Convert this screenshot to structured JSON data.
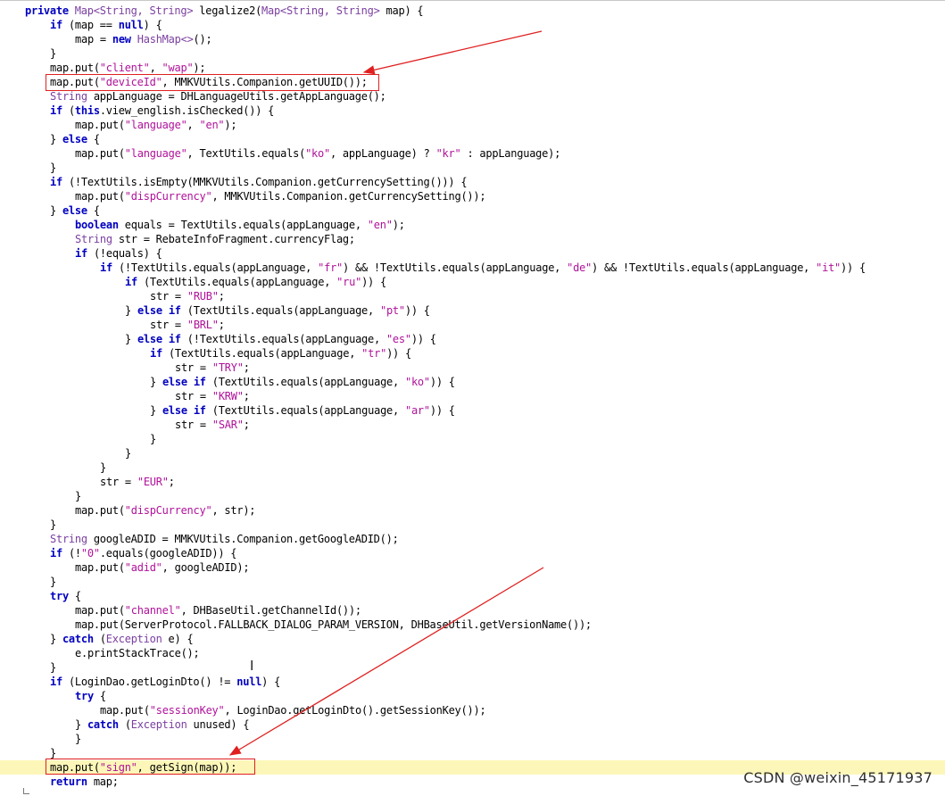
{
  "editor": {
    "highlight_line_index": 53,
    "lines": [
      {
        "indent": 1,
        "tokens": [
          [
            "k",
            "private "
          ],
          [
            "t",
            "Map<String, String> "
          ],
          [
            "p",
            "legalize2("
          ],
          [
            "t",
            "Map<String, String> "
          ],
          [
            "p",
            "map) {"
          ]
        ]
      },
      {
        "indent": 2,
        "tokens": [
          [
            "k",
            "if "
          ],
          [
            "p",
            "(map == "
          ],
          [
            "k",
            "null"
          ],
          [
            "p",
            ") {"
          ]
        ]
      },
      {
        "indent": 3,
        "tokens": [
          [
            "p",
            "map = "
          ],
          [
            "k",
            "new "
          ],
          [
            "t",
            "HashMap<>"
          ],
          [
            "p",
            "();"
          ]
        ]
      },
      {
        "indent": 2,
        "tokens": [
          [
            "p",
            "}"
          ]
        ]
      },
      {
        "indent": 2,
        "tokens": [
          [
            "p",
            "map.put("
          ],
          [
            "s",
            "\"client\""
          ],
          [
            "p",
            ", "
          ],
          [
            "s",
            "\"wap\""
          ],
          [
            "p",
            ");"
          ]
        ]
      },
      {
        "indent": 2,
        "tokens": [
          [
            "p",
            "map.put("
          ],
          [
            "s",
            "\"deviceId\""
          ],
          [
            "p",
            ", MMKVUtils.Companion.getUUID());"
          ]
        ]
      },
      {
        "indent": 2,
        "tokens": [
          [
            "t",
            "String "
          ],
          [
            "p",
            "appLanguage = DHLanguageUtils.getAppLanguage();"
          ]
        ]
      },
      {
        "indent": 2,
        "tokens": [
          [
            "k",
            "if "
          ],
          [
            "p",
            "("
          ],
          [
            "k",
            "this"
          ],
          [
            "p",
            ".view_english.isChecked()) {"
          ]
        ]
      },
      {
        "indent": 3,
        "tokens": [
          [
            "p",
            "map.put("
          ],
          [
            "s",
            "\"language\""
          ],
          [
            "p",
            ", "
          ],
          [
            "s",
            "\"en\""
          ],
          [
            "p",
            ");"
          ]
        ]
      },
      {
        "indent": 2,
        "tokens": [
          [
            "p",
            "} "
          ],
          [
            "k",
            "else "
          ],
          [
            "p",
            "{"
          ]
        ]
      },
      {
        "indent": 3,
        "tokens": [
          [
            "p",
            "map.put("
          ],
          [
            "s",
            "\"language\""
          ],
          [
            "p",
            ", TextUtils.equals("
          ],
          [
            "s",
            "\"ko\""
          ],
          [
            "p",
            ", appLanguage) ? "
          ],
          [
            "s",
            "\"kr\""
          ],
          [
            "p",
            " : appLanguage);"
          ]
        ]
      },
      {
        "indent": 2,
        "tokens": [
          [
            "p",
            "}"
          ]
        ]
      },
      {
        "indent": 2,
        "tokens": [
          [
            "k",
            "if "
          ],
          [
            "p",
            "(!TextUtils.isEmpty(MMKVUtils.Companion.getCurrencySetting())) {"
          ]
        ]
      },
      {
        "indent": 3,
        "tokens": [
          [
            "p",
            "map.put("
          ],
          [
            "s",
            "\"dispCurrency\""
          ],
          [
            "p",
            ", MMKVUtils.Companion.getCurrencySetting());"
          ]
        ]
      },
      {
        "indent": 2,
        "tokens": [
          [
            "p",
            "} "
          ],
          [
            "k",
            "else "
          ],
          [
            "p",
            "{"
          ]
        ]
      },
      {
        "indent": 3,
        "tokens": [
          [
            "k",
            "boolean "
          ],
          [
            "p",
            "equals = TextUtils.equals(appLanguage, "
          ],
          [
            "s",
            "\"en\""
          ],
          [
            "p",
            ");"
          ]
        ]
      },
      {
        "indent": 3,
        "tokens": [
          [
            "t",
            "String "
          ],
          [
            "p",
            "str = RebateInfoFragment.currencyFlag;"
          ]
        ]
      },
      {
        "indent": 3,
        "tokens": [
          [
            "k",
            "if "
          ],
          [
            "p",
            "(!equals) {"
          ]
        ]
      },
      {
        "indent": 4,
        "tokens": [
          [
            "k",
            "if "
          ],
          [
            "p",
            "(!TextUtils.equals(appLanguage, "
          ],
          [
            "s",
            "\"fr\""
          ],
          [
            "p",
            ") && !TextUtils.equals(appLanguage, "
          ],
          [
            "s",
            "\"de\""
          ],
          [
            "p",
            ") && !TextUtils.equals(appLanguage, "
          ],
          [
            "s",
            "\"it\""
          ],
          [
            "p",
            ")) {"
          ]
        ]
      },
      {
        "indent": 5,
        "tokens": [
          [
            "k",
            "if "
          ],
          [
            "p",
            "(TextUtils.equals(appLanguage, "
          ],
          [
            "s",
            "\"ru\""
          ],
          [
            "p",
            ")) {"
          ]
        ]
      },
      {
        "indent": 6,
        "tokens": [
          [
            "p",
            "str = "
          ],
          [
            "s",
            "\"RUB\""
          ],
          [
            "p",
            ";"
          ]
        ]
      },
      {
        "indent": 5,
        "tokens": [
          [
            "p",
            "} "
          ],
          [
            "k",
            "else if "
          ],
          [
            "p",
            "(TextUtils.equals(appLanguage, "
          ],
          [
            "s",
            "\"pt\""
          ],
          [
            "p",
            ")) {"
          ]
        ]
      },
      {
        "indent": 6,
        "tokens": [
          [
            "p",
            "str = "
          ],
          [
            "s",
            "\"BRL\""
          ],
          [
            "p",
            ";"
          ]
        ]
      },
      {
        "indent": 5,
        "tokens": [
          [
            "p",
            "} "
          ],
          [
            "k",
            "else if "
          ],
          [
            "p",
            "(!TextUtils.equals(appLanguage, "
          ],
          [
            "s",
            "\"es\""
          ],
          [
            "p",
            ")) {"
          ]
        ]
      },
      {
        "indent": 6,
        "tokens": [
          [
            "k",
            "if "
          ],
          [
            "p",
            "(TextUtils.equals(appLanguage, "
          ],
          [
            "s",
            "\"tr\""
          ],
          [
            "p",
            ")) {"
          ]
        ]
      },
      {
        "indent": 7,
        "tokens": [
          [
            "p",
            "str = "
          ],
          [
            "s",
            "\"TRY\""
          ],
          [
            "p",
            ";"
          ]
        ]
      },
      {
        "indent": 6,
        "tokens": [
          [
            "p",
            "} "
          ],
          [
            "k",
            "else if "
          ],
          [
            "p",
            "(TextUtils.equals(appLanguage, "
          ],
          [
            "s",
            "\"ko\""
          ],
          [
            "p",
            ")) {"
          ]
        ]
      },
      {
        "indent": 7,
        "tokens": [
          [
            "p",
            "str = "
          ],
          [
            "s",
            "\"KRW\""
          ],
          [
            "p",
            ";"
          ]
        ]
      },
      {
        "indent": 6,
        "tokens": [
          [
            "p",
            "} "
          ],
          [
            "k",
            "else if "
          ],
          [
            "p",
            "(TextUtils.equals(appLanguage, "
          ],
          [
            "s",
            "\"ar\""
          ],
          [
            "p",
            ")) {"
          ]
        ]
      },
      {
        "indent": 7,
        "tokens": [
          [
            "p",
            "str = "
          ],
          [
            "s",
            "\"SAR\""
          ],
          [
            "p",
            ";"
          ]
        ]
      },
      {
        "indent": 6,
        "tokens": [
          [
            "p",
            "}"
          ]
        ]
      },
      {
        "indent": 5,
        "tokens": [
          [
            "p",
            "}"
          ]
        ]
      },
      {
        "indent": 4,
        "tokens": [
          [
            "p",
            "}"
          ]
        ]
      },
      {
        "indent": 4,
        "tokens": [
          [
            "p",
            "str = "
          ],
          [
            "s",
            "\"EUR\""
          ],
          [
            "p",
            ";"
          ]
        ]
      },
      {
        "indent": 3,
        "tokens": [
          [
            "p",
            "}"
          ]
        ]
      },
      {
        "indent": 3,
        "tokens": [
          [
            "p",
            "map.put("
          ],
          [
            "s",
            "\"dispCurrency\""
          ],
          [
            "p",
            ", str);"
          ]
        ]
      },
      {
        "indent": 2,
        "tokens": [
          [
            "p",
            "}"
          ]
        ]
      },
      {
        "indent": 2,
        "tokens": [
          [
            "t",
            "String "
          ],
          [
            "p",
            "googleADID = MMKVUtils.Companion.getGoogleADID();"
          ]
        ]
      },
      {
        "indent": 2,
        "tokens": [
          [
            "k",
            "if "
          ],
          [
            "p",
            "(!"
          ],
          [
            "s",
            "\"0\""
          ],
          [
            "p",
            ".equals(googleADID)) {"
          ]
        ]
      },
      {
        "indent": 3,
        "tokens": [
          [
            "p",
            "map.put("
          ],
          [
            "s",
            "\"adid\""
          ],
          [
            "p",
            ", googleADID);"
          ]
        ]
      },
      {
        "indent": 2,
        "tokens": [
          [
            "p",
            "}"
          ]
        ]
      },
      {
        "indent": 2,
        "tokens": [
          [
            "k",
            "try "
          ],
          [
            "p",
            "{"
          ]
        ]
      },
      {
        "indent": 3,
        "tokens": [
          [
            "p",
            "map.put("
          ],
          [
            "s",
            "\"channel\""
          ],
          [
            "p",
            ", DHBaseUtil.getChannelId());"
          ]
        ]
      },
      {
        "indent": 3,
        "tokens": [
          [
            "p",
            "map.put(ServerProtocol.FALLBACK_DIALOG_PARAM_VERSION, DHBaseUtil.getVersionName());"
          ]
        ]
      },
      {
        "indent": 2,
        "tokens": [
          [
            "p",
            "} "
          ],
          [
            "k",
            "catch "
          ],
          [
            "p",
            "("
          ],
          [
            "t",
            "Exception "
          ],
          [
            "p",
            "e) {"
          ]
        ]
      },
      {
        "indent": 3,
        "tokens": [
          [
            "p",
            "e.printStackTrace();"
          ]
        ]
      },
      {
        "indent": 2,
        "tokens": [
          [
            "p",
            "}"
          ]
        ]
      },
      {
        "indent": 2,
        "tokens": [
          [
            "k",
            "if "
          ],
          [
            "p",
            "(LoginDao.getLoginDto() != "
          ],
          [
            "k",
            "null"
          ],
          [
            "p",
            ") {"
          ]
        ]
      },
      {
        "indent": 3,
        "tokens": [
          [
            "k",
            "try "
          ],
          [
            "p",
            "{"
          ]
        ]
      },
      {
        "indent": 4,
        "tokens": [
          [
            "p",
            "map.put("
          ],
          [
            "s",
            "\"sessionKey\""
          ],
          [
            "p",
            ", LoginDao.getLoginDto().getSessionKey());"
          ]
        ]
      },
      {
        "indent": 3,
        "tokens": [
          [
            "p",
            "} "
          ],
          [
            "k",
            "catch "
          ],
          [
            "p",
            "("
          ],
          [
            "t",
            "Exception "
          ],
          [
            "p",
            "unused) {"
          ]
        ]
      },
      {
        "indent": 3,
        "tokens": [
          [
            "p",
            "}"
          ]
        ]
      },
      {
        "indent": 2,
        "tokens": [
          [
            "p",
            "}"
          ]
        ]
      },
      {
        "indent": 2,
        "tokens": [
          [
            "p",
            "map.put("
          ],
          [
            "s",
            "\"sign\""
          ],
          [
            "p",
            ", getSign(map));"
          ]
        ]
      },
      {
        "indent": 2,
        "tokens": [
          [
            "k",
            "return "
          ],
          [
            "p",
            "map;"
          ]
        ]
      }
    ]
  },
  "annotations": {
    "box_color": "#e02020",
    "arrow_color": "#e02020",
    "highlight_color": "#fcf7b8"
  },
  "cursor": {
    "icon": "text-cursor-icon",
    "glyph": "I"
  },
  "watermark": {
    "text": "CSDN @weixin_45171937"
  },
  "colors": {
    "keyword": "#0000c0",
    "type": "#7b3fa0",
    "string": "#b0129a",
    "plain": "#000000"
  }
}
